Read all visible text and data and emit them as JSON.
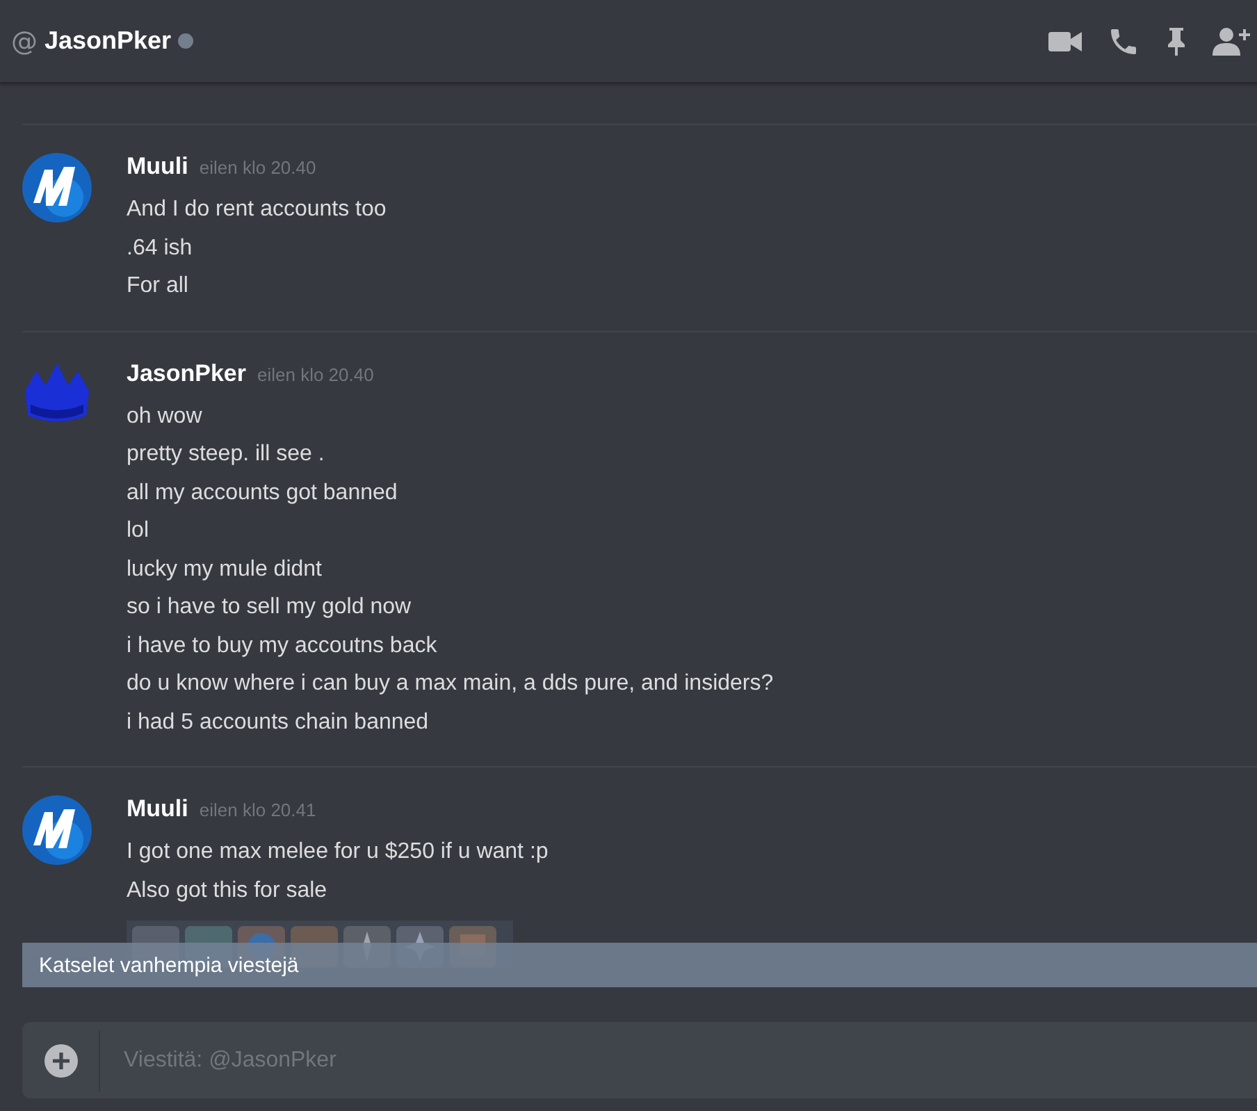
{
  "header": {
    "at_sign": "@",
    "title": "JasonPker",
    "online": false
  },
  "messages": [
    {
      "author": "Muuli",
      "avatar": {
        "kind": "m-logo"
      },
      "timestamp": "eilen klo 20.40",
      "lines": [
        "And I do rent accounts too",
        ".64 ish",
        "For all"
      ]
    },
    {
      "author": "JasonPker",
      "avatar": {
        "kind": "crown"
      },
      "timestamp": "eilen klo 20.40",
      "lines": [
        "oh wow",
        "pretty steep. ill see .",
        "all my accounts got banned",
        "lol",
        "lucky my mule didnt",
        "so i have to sell my gold now",
        "i have to buy my accoutns back",
        "do u know where i can buy a max main, a dds pure, and insiders?",
        "i had 5 accounts chain banned"
      ]
    },
    {
      "author": "Muuli",
      "avatar": {
        "kind": "m-logo"
      },
      "timestamp": "eilen klo 20.41",
      "lines": [
        "I got one max melee for u $250 if u want :p",
        "Also got this for sale"
      ],
      "attachment": {
        "kind": "picture"
      }
    }
  ],
  "older_messages_bar": "Katselet vanhempia viestejä",
  "composer": {
    "placeholder": "Viestitä: @JasonPker"
  }
}
